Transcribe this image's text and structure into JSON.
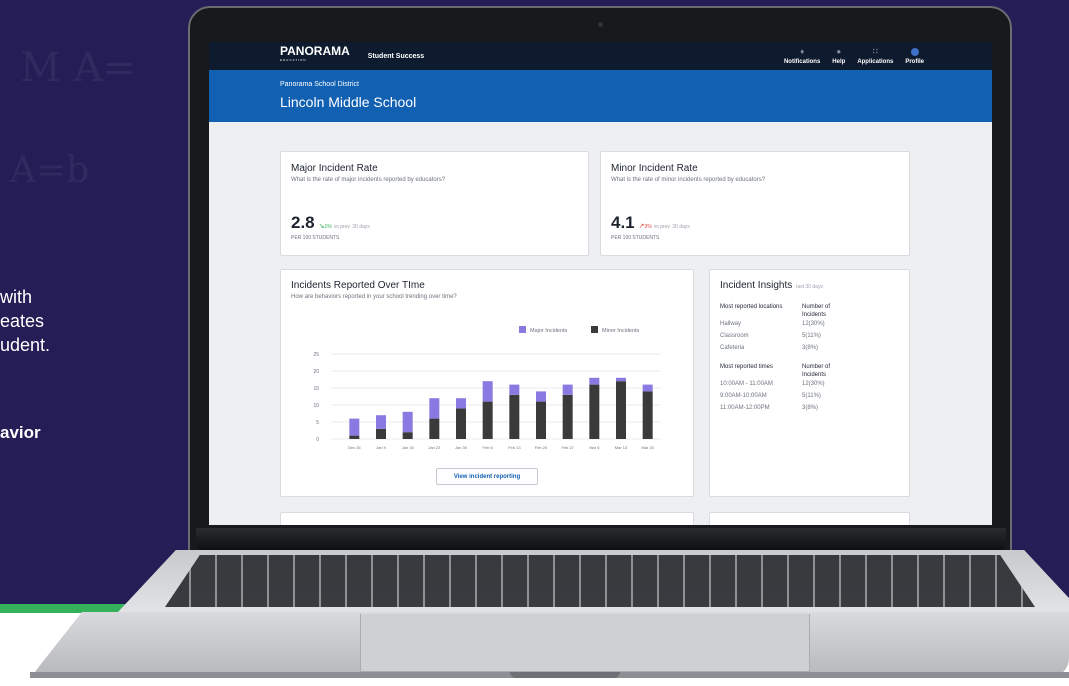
{
  "promo": {
    "line1": "with",
    "line2": "eates",
    "line3": "udent.",
    "bold": "avior"
  },
  "app": {
    "logo": "PANORAMA",
    "logo_sub": "EDUCATION",
    "product": "Student Success",
    "nav": [
      {
        "label": "Notifications",
        "icon": "bell-icon"
      },
      {
        "label": "Help",
        "icon": "help-icon"
      },
      {
        "label": "Applications",
        "icon": "grid-icon"
      },
      {
        "label": "Profile",
        "icon": "profile-icon"
      }
    ],
    "district": "Panorama School District",
    "school": "Lincoln Middle School"
  },
  "major": {
    "title": "Major Incident Rate",
    "subtitle": "What is the rate of major incidents reported by educators?",
    "value": "2.8",
    "change": "1%",
    "change_text": "vs prev. 30 days",
    "per": "PER 100 STUDENTS",
    "trend_color": "#2fa84f"
  },
  "minor": {
    "title": "Minor Incident Rate",
    "subtitle": "What is the rate of minor incidents reported by educators?",
    "value": "4.1",
    "change": "3%",
    "change_text": "vs prev. 30 days",
    "per": "PER 100 STUDENTS",
    "trend_color": "#e0413a"
  },
  "trend_card": {
    "title": "Incidents Reported Over TIme",
    "subtitle": "How are behaviors reported in your school trending over time?",
    "button": "View incident reporting"
  },
  "insights": {
    "title": "Incident Insights",
    "period": "last 30 days",
    "locations_header": "Most reported locations",
    "count_header": "Number of Incidents",
    "locations": [
      {
        "name": "Hallway",
        "count": "12(30%)"
      },
      {
        "name": "Classroom",
        "count": "5(11%)"
      },
      {
        "name": "Cafeteria",
        "count": "3(8%)"
      }
    ],
    "times_header": "Most reported times",
    "times_count_header": "Number of Incidents",
    "times": [
      {
        "name": "10:00AM - 11:00AM",
        "count": "12(30%)"
      },
      {
        "name": "9:00AM-10:00AM",
        "count": "5(11%)"
      },
      {
        "name": "11:00AM-12:00PM",
        "count": "3(8%)"
      }
    ]
  },
  "colors": {
    "major": "#8a79e0",
    "minor": "#3a3a3a",
    "brand_blue": "#1160b2"
  },
  "chart_data": {
    "type": "bar",
    "stacked": true,
    "categories": [
      "Dec 26",
      "Jan 9",
      "Jan 16",
      "Jan 23",
      "Jan 30",
      "Feb 6",
      "Feb 13",
      "Feb 20",
      "Feb 27",
      "Mar 6",
      "Mar 13",
      "Mar 20"
    ],
    "series": [
      {
        "name": "Minor Incidents",
        "values": [
          1,
          3,
          2,
          6,
          9,
          11,
          13,
          11,
          13,
          16,
          17,
          14
        ]
      },
      {
        "name": "Major Incidents",
        "values": [
          5,
          4,
          6,
          6,
          3,
          6,
          3,
          3,
          3,
          2,
          1,
          2
        ]
      }
    ],
    "yticks": [
      0,
      5,
      10,
      15,
      20,
      25
    ],
    "ylim": [
      0,
      25
    ],
    "legend": "top-right",
    "grid": true
  }
}
